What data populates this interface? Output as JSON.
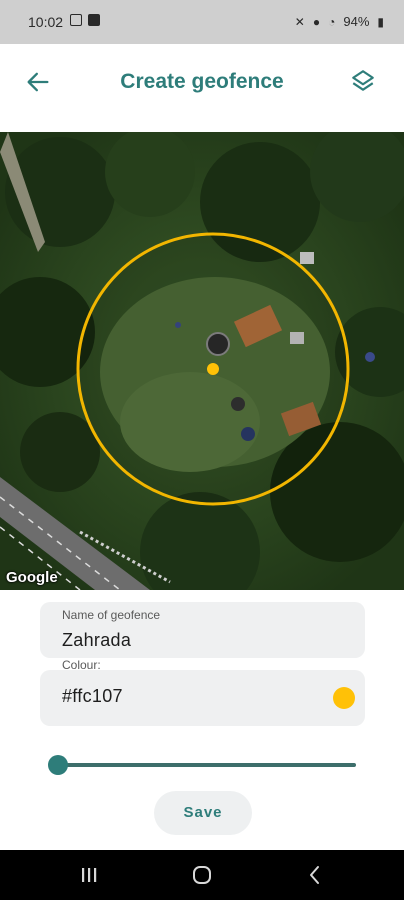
{
  "status_bar": {
    "time": "10:02",
    "battery": "94%",
    "icons": [
      "photo-icon",
      "calendar-check-icon",
      "mute-icon",
      "location-icon",
      "wifi-icon",
      "battery-icon"
    ]
  },
  "app_bar": {
    "title": "Create geofence",
    "back_icon": "arrow-back-icon",
    "layers_icon": "layers-icon"
  },
  "map": {
    "attribution": "Google",
    "circle_color": "#ffc107"
  },
  "form": {
    "name_label": "Name of geofence",
    "name_value": "Zahrada",
    "colour_label": "Colour:",
    "colour_value": "#ffc107",
    "colour_swatch": "#ffc107",
    "radius_fraction": 0.0,
    "save_label": "Save"
  },
  "nav_bar": {
    "icons": [
      "recent-apps-icon",
      "home-icon",
      "back-icon"
    ]
  },
  "colors": {
    "accent": "#2e7d7a",
    "field_bg": "#eff0f1"
  }
}
